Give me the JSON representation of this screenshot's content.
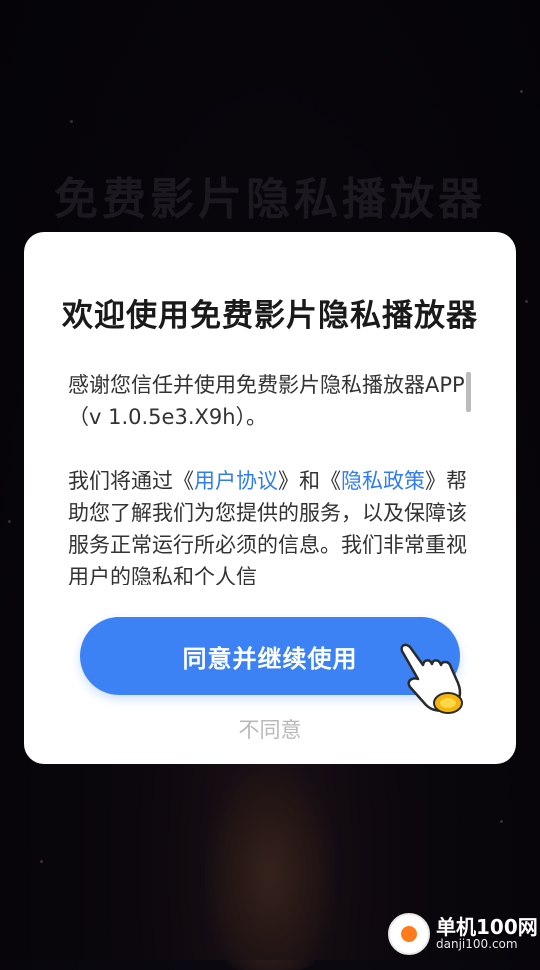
{
  "background": {
    "title": "免费影片隐私播放器"
  },
  "dialog": {
    "title": "欢迎使用免费影片隐私播放器",
    "paragraph1": "感谢您信任并使用免费影片隐私播放器APP（v 1.0.5e3.X9h）。",
    "paragraph2_part1": "我们将通过《",
    "paragraph2_link1": "用户协议",
    "paragraph2_part2": "》和《",
    "paragraph2_link2": "隐私政策",
    "paragraph2_part3": "》帮助您了解我们为您提供的服务，以及保障该服务正常运行所必须的信息。我们非常重视用户的隐私和个人信",
    "agree_label": "同意并继续使用",
    "disagree_label": "不同意"
  },
  "watermark": {
    "name": "单机100网",
    "url": "danji100.com"
  },
  "colors": {
    "primary_button": "#3d82f5",
    "link": "#2f7cf6",
    "disagree_text": "#b8b8b8"
  }
}
